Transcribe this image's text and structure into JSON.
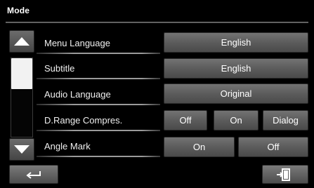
{
  "screen": {
    "title": "Mode"
  },
  "rows": [
    {
      "label": "Menu Language",
      "options": [
        "English"
      ]
    },
    {
      "label": "Subtitle",
      "options": [
        "English"
      ]
    },
    {
      "label": "Audio Language",
      "options": [
        "Original"
      ]
    },
    {
      "label": "D.Range Compres.",
      "options": [
        "Off",
        "On",
        "Dialog"
      ]
    },
    {
      "label": "Angle Mark",
      "options": [
        "On",
        "Off"
      ]
    }
  ],
  "icons": {
    "scroll_up": "triangle-up-icon",
    "scroll_down": "triangle-down-icon",
    "back": "return-arrow-icon",
    "exit": "exit-door-icon"
  },
  "colors": {
    "background": "#000000",
    "button": "#5c5c5c",
    "text": "#ffffff"
  }
}
